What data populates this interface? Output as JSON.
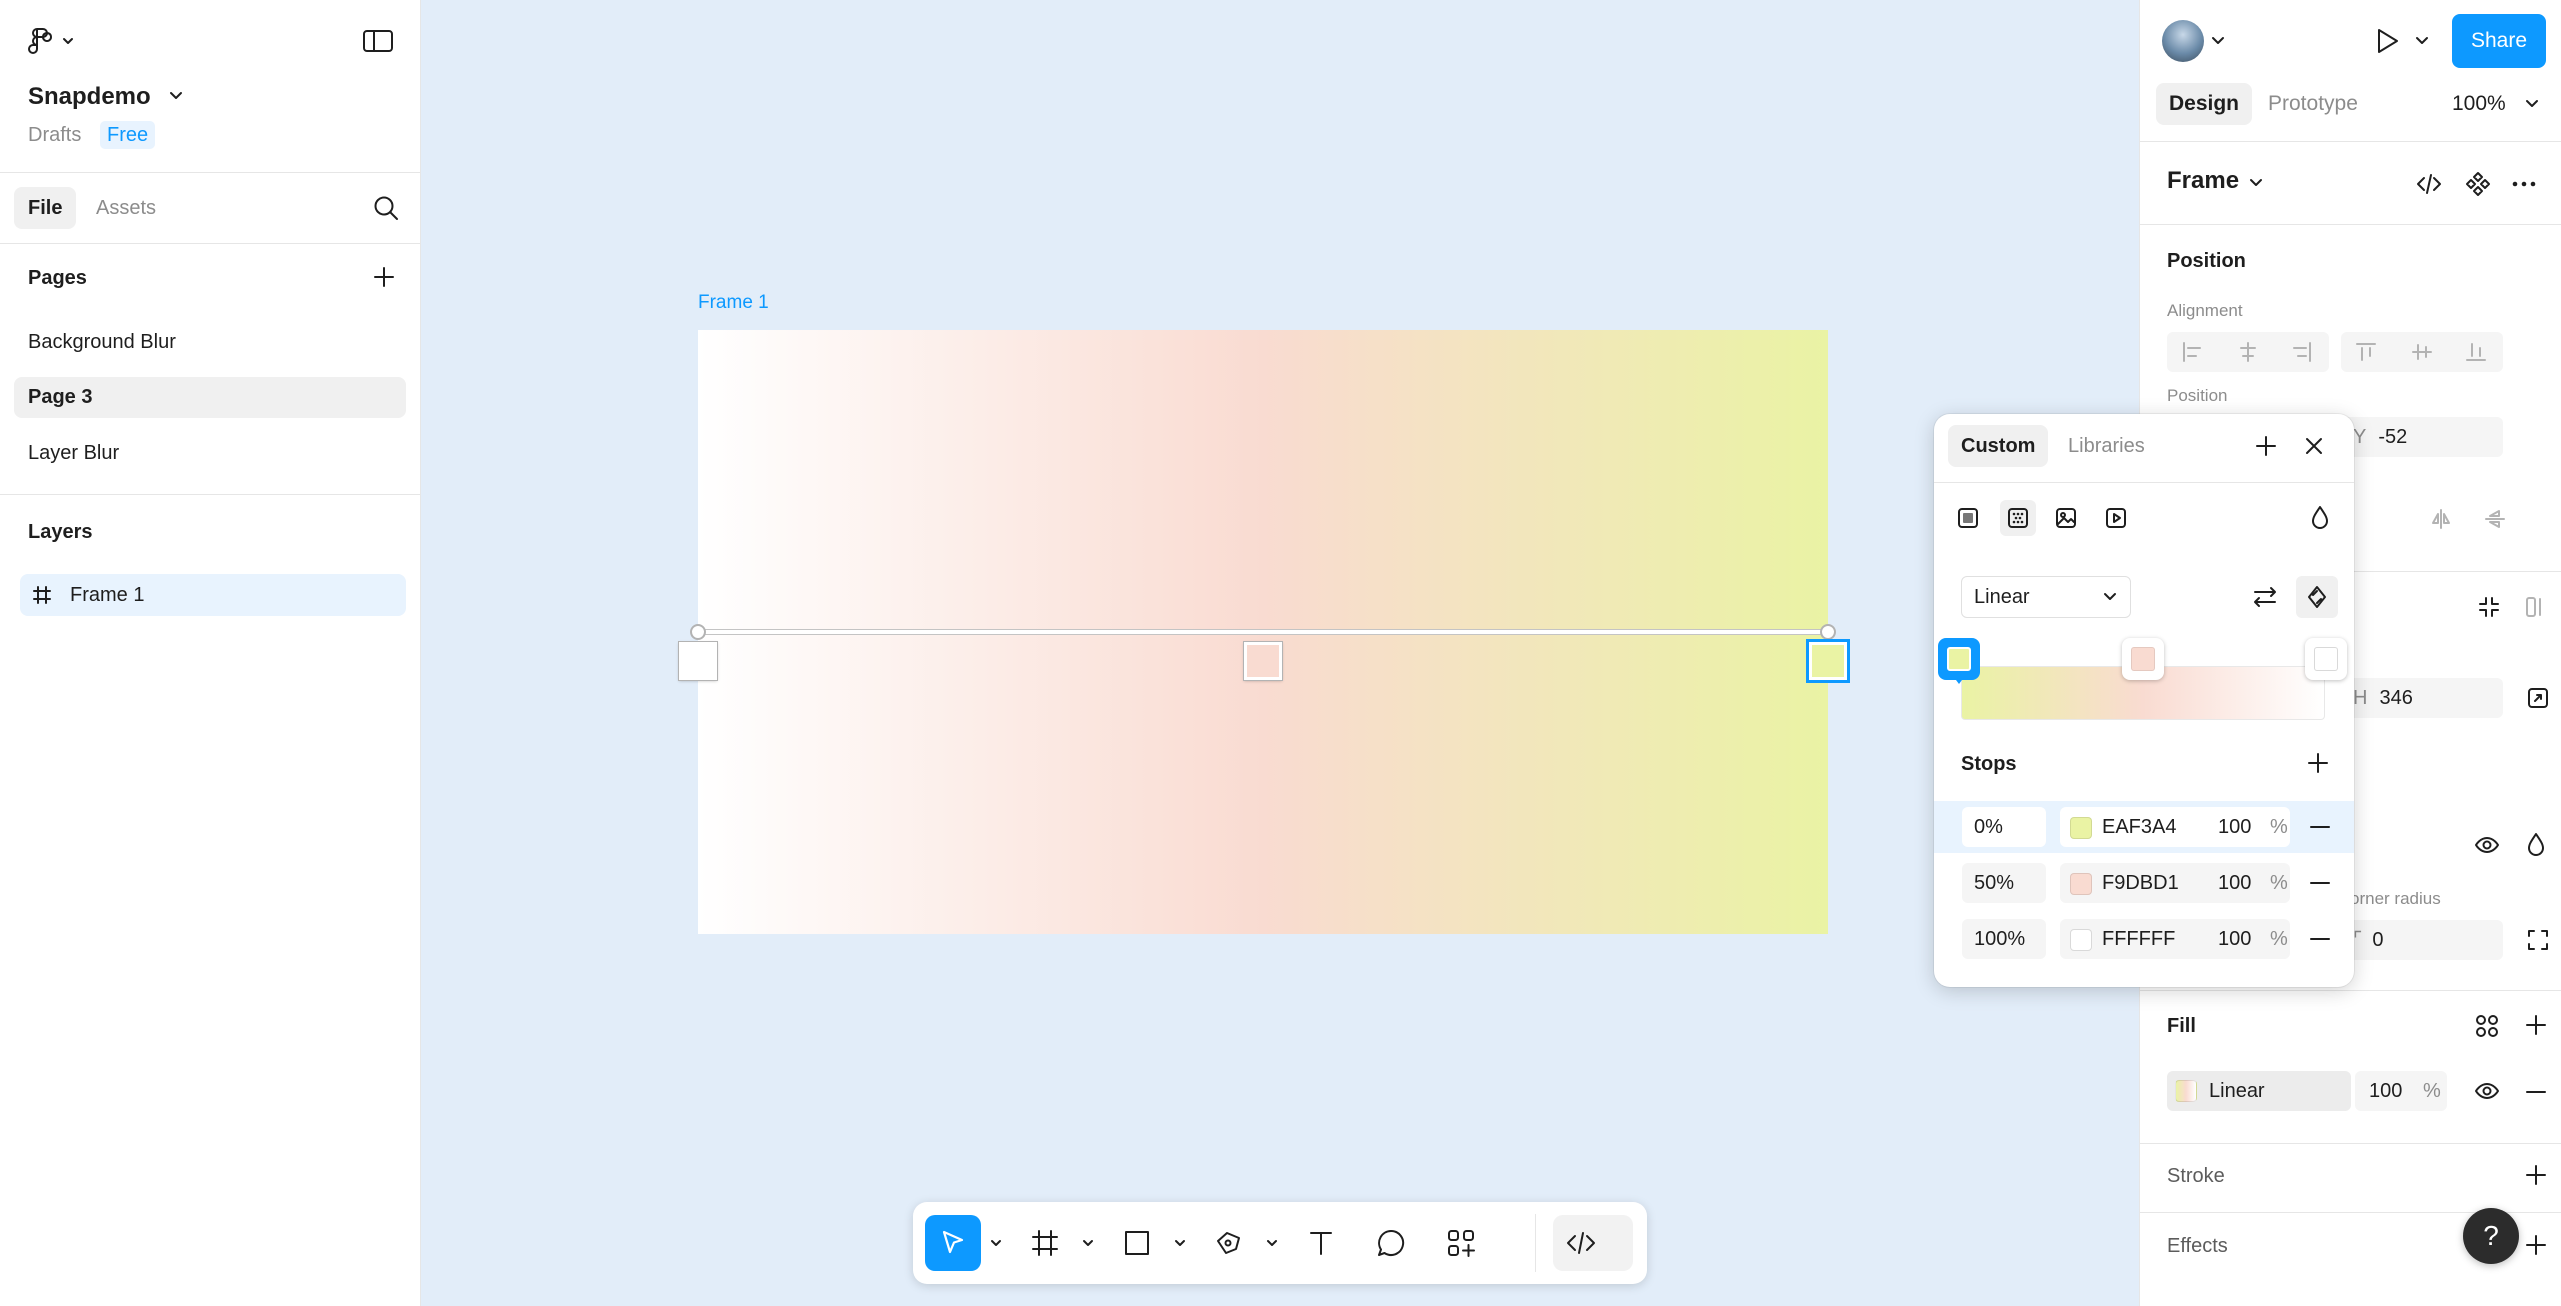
{
  "app": {
    "file_name": "Snapdemo",
    "drafts": "Drafts",
    "plan_badge": "Free"
  },
  "left": {
    "tabs": [
      "File",
      "Assets"
    ],
    "pages_title": "Pages",
    "pages": [
      "Background Blur",
      "Page 3",
      "Layer Blur"
    ],
    "active_page": "Page 3",
    "layers_title": "Layers",
    "layers": [
      "Frame 1"
    ]
  },
  "canvas": {
    "frame_label": "Frame 1"
  },
  "right": {
    "share_label": "Share",
    "tabs": [
      "Design",
      "Prototype"
    ],
    "zoom": "100%",
    "frame_title": "Frame",
    "position_title": "Position",
    "alignment_label": "Alignment",
    "position_label": "Position",
    "y_label": "Y",
    "y_value": "-52",
    "h_label": "H",
    "h_value": "346",
    "corner_radius_label": "orner radius",
    "corner_radius_value": "0",
    "fill_title": "Fill",
    "fill_type": "Linear",
    "fill_opacity": "100",
    "fill_pct": "%",
    "stroke_title": "Stroke",
    "effects_title": "Effects",
    "help": "?"
  },
  "popup": {
    "tabs": [
      "Custom",
      "Libraries"
    ],
    "gradient_type": "Linear",
    "stops_title": "Stops",
    "stops": [
      {
        "position": "0%",
        "hex": "EAF3A4",
        "opacity": "100",
        "pct": "%",
        "color": "#EAF3A4"
      },
      {
        "position": "50%",
        "hex": "F9DBD1",
        "opacity": "100",
        "pct": "%",
        "color": "#F9DBD1"
      },
      {
        "position": "100%",
        "hex": "FFFFFF",
        "opacity": "100",
        "pct": "%",
        "color": "#FFFFFF"
      }
    ]
  },
  "colors": {
    "accent": "#0d99ff",
    "canvas_bg": "#e2edf9"
  }
}
